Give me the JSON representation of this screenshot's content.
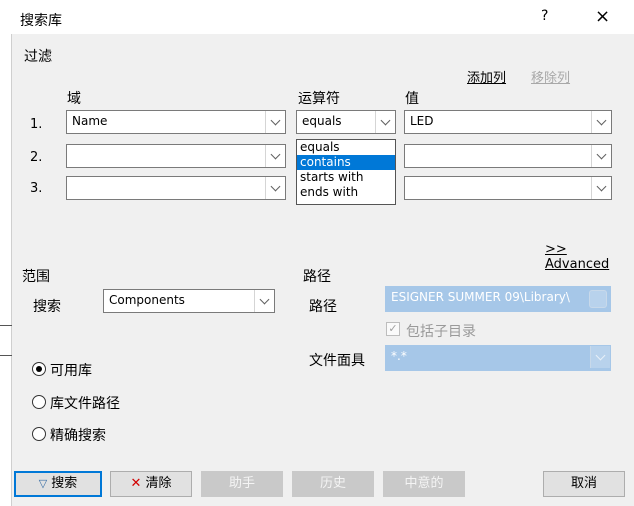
{
  "window": {
    "title": "搜索库",
    "help": "?",
    "close": "×"
  },
  "filter": {
    "label": "过滤",
    "add_column": "添加列",
    "remove_column": "移除列",
    "headers": {
      "domain": "域",
      "operator": "运算符",
      "value": "值"
    },
    "rows": [
      {
        "num": "1.",
        "domain": "Name",
        "operator": "equals",
        "value": "LED"
      },
      {
        "num": "2.",
        "domain": "",
        "operator": "",
        "value": ""
      },
      {
        "num": "3.",
        "domain": "",
        "operator": "",
        "value": ""
      }
    ],
    "operator_options": [
      "equals",
      "contains",
      "starts with",
      "ends with"
    ],
    "advanced": ">> Advanced"
  },
  "scope": {
    "label": "范围",
    "search_label": "搜索",
    "search_value": "Components",
    "options": [
      "可用库",
      "库文件路径",
      "精确搜索"
    ]
  },
  "path": {
    "label": "路径",
    "path_label": "路径",
    "path_value": "ESIGNER SUMMER 09\\Library\\",
    "include_subdirs": "包括子目录",
    "mask_label": "文件面具",
    "mask_value": "*.*"
  },
  "buttons": {
    "search": "搜索",
    "clear": "清除",
    "helper": "助手",
    "history": "历史",
    "favorites": "中意的",
    "cancel": "取消"
  }
}
